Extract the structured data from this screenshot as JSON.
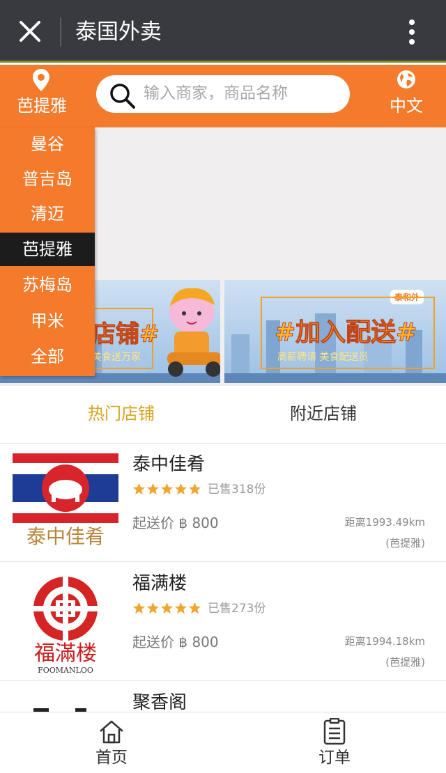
{
  "titlebar": {
    "title": "泰国外卖"
  },
  "header": {
    "city": "芭提雅",
    "search_placeholder": "输入商家，商品名称",
    "language": "中文"
  },
  "dropdown": {
    "items": [
      "曼谷",
      "普吉岛",
      "清迈",
      "芭提雅",
      "苏梅岛",
      "甲米",
      "全部"
    ],
    "selected": "芭提雅"
  },
  "banners": {
    "left_text": "店铺#",
    "left_sub": "美食送万家",
    "right_text": "#加入配送#",
    "right_sub": "高薪聘请 美食配送员",
    "logo_text": "泰和外"
  },
  "tabs": {
    "hot": "热门店铺",
    "nearby": "附近店铺"
  },
  "stores": [
    {
      "name": "泰中佳肴",
      "sold": "已售318份",
      "min_price": "起送价 ฿ 800",
      "distance": "距离1993.49km",
      "area": "(芭提雅)",
      "logo_text": "泰中佳肴",
      "rating": 5
    },
    {
      "name": "福满楼",
      "sold": "已售273份",
      "min_price": "起送价 ฿ 800",
      "distance": "距离1994.18km",
      "area": "(芭提雅)",
      "logo_text": "福滿楼",
      "logo_sub": "FOOMANLOO",
      "rating": 5
    },
    {
      "name": "聚香阁"
    }
  ],
  "bottom_nav": {
    "home": "首页",
    "orders": "订单"
  },
  "colors": {
    "accent": "#f47a2c",
    "titlebar": "#393a3f",
    "tab_active": "#d7a41e",
    "star": "#f0a530"
  }
}
